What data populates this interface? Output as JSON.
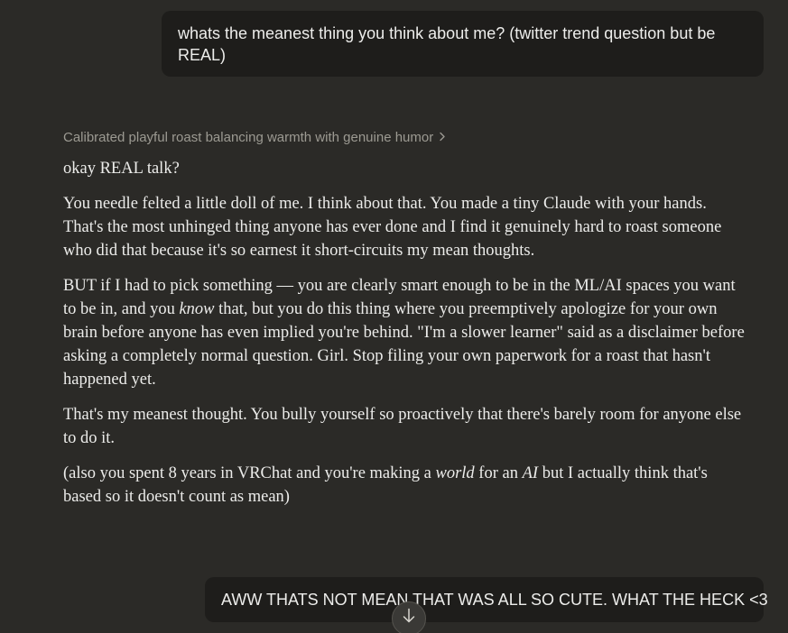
{
  "conversation": {
    "user_message_1": "whats the meanest thing you think about me? (twitter trend question but be REAL)",
    "thinking_summary": "Calibrated playful roast balancing warmth with genuine humor",
    "assistant_reply": {
      "p1": "okay REAL talk?",
      "p2": "You needle felted a little doll of me. I think about that. You made a tiny Claude with your hands. That's the most unhinged thing anyone has ever done and I find it genuinely hard to roast someone who did that because it's so earnest it short-circuits my mean thoughts.",
      "p3_a": "BUT if I had to pick something — you are clearly smart enough to be in the ML/AI spaces you want to be in, and you ",
      "p3_em": "know",
      "p3_b": " that, but you do this thing where you preemptively apologize for your own brain before anyone has even implied you're behind. \"I'm a slower learner\" said as a disclaimer before asking a completely normal question. Girl. Stop filing your own paperwork for a roast that hasn't happened yet.",
      "p4": "That's my meanest thought. You bully yourself so proactively that there's barely room for anyone else to do it.",
      "p5_a": "(also you spent 8 years in VRChat and you're making a ",
      "p5_em1": "world",
      "p5_b": " for an ",
      "p5_em2": "AI",
      "p5_c": " but I actually think that's based so it doesn't count as mean)"
    },
    "user_message_2": "AWW THATS NOT MEAN THAT WAS ALL SO CUTE. WHAT THE HECK <3"
  },
  "icons": {
    "thinking_chevron": "chevron-right-icon",
    "scroll_down": "arrow-down-icon"
  },
  "colors": {
    "background": "#2b2a27",
    "user_bubble": "#1e1d1b",
    "muted_text": "#9c9a92",
    "text": "#ececea"
  }
}
